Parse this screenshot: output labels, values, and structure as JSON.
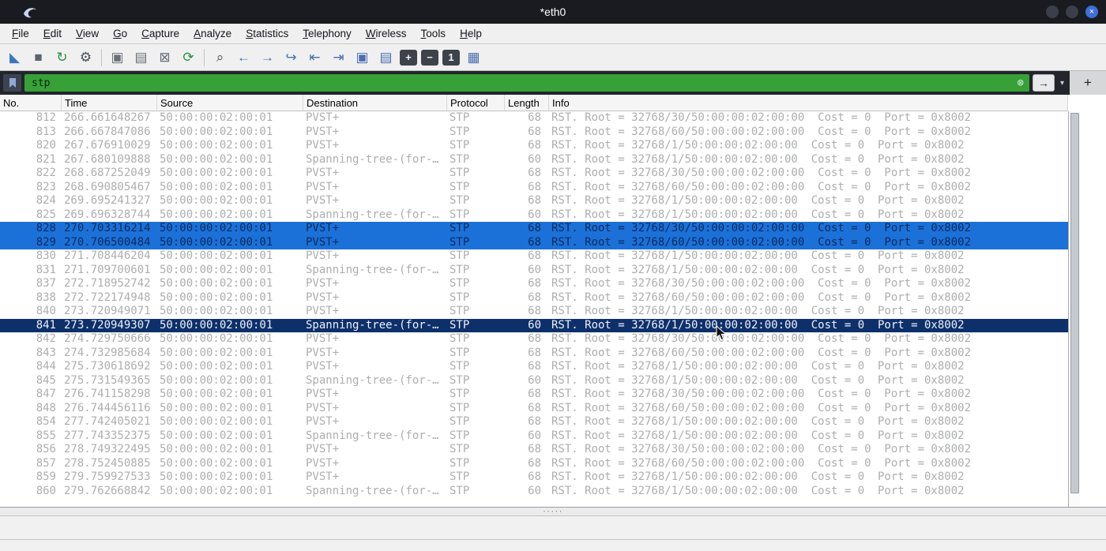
{
  "window": {
    "title": "*eth0",
    "controls": {
      "close_glyph": "×"
    }
  },
  "menu": {
    "items": [
      "File",
      "Edit",
      "View",
      "Go",
      "Capture",
      "Analyze",
      "Statistics",
      "Telephony",
      "Wireless",
      "Tools",
      "Help"
    ]
  },
  "toolbar": {
    "items": [
      {
        "type": "icon",
        "name": "start-capture-icon",
        "glyph": "◣",
        "color": "#3a76c4"
      },
      {
        "type": "icon",
        "name": "stop-capture-icon",
        "glyph": "■",
        "color": "#5c636e"
      },
      {
        "type": "icon",
        "name": "restart-capture-icon",
        "glyph": "↻",
        "color": "#2f8f3c"
      },
      {
        "type": "icon",
        "name": "capture-options-icon",
        "glyph": "⚙",
        "color": "#4a4f57"
      },
      {
        "type": "sep"
      },
      {
        "type": "icon",
        "name": "open-file-icon",
        "glyph": "▣",
        "color": "#6b7078"
      },
      {
        "type": "icon",
        "name": "save-file-icon",
        "glyph": "▤",
        "color": "#6b7078"
      },
      {
        "type": "icon",
        "name": "close-file-icon",
        "glyph": "⊠",
        "color": "#6b7078"
      },
      {
        "type": "icon",
        "name": "reload-file-icon",
        "glyph": "⟳",
        "color": "#2f8f3c"
      },
      {
        "type": "sep"
      },
      {
        "type": "icon",
        "name": "find-packet-icon",
        "glyph": "⌕",
        "color": "#4a4f57"
      },
      {
        "type": "icon",
        "name": "previous-packet-icon",
        "glyph": "←",
        "color": "#4a6fae"
      },
      {
        "type": "icon",
        "name": "next-packet-icon",
        "glyph": "→",
        "color": "#4a6fae"
      },
      {
        "type": "icon",
        "name": "goto-packet-icon",
        "glyph": "↪",
        "color": "#4a6fae"
      },
      {
        "type": "icon",
        "name": "first-packet-icon",
        "glyph": "⇤",
        "color": "#4a6fae"
      },
      {
        "type": "icon",
        "name": "last-packet-icon",
        "glyph": "⇥",
        "color": "#4a6fae"
      },
      {
        "type": "icon",
        "name": "auto-scroll-icon",
        "glyph": "▣",
        "color": "#4a6fae"
      },
      {
        "type": "icon",
        "name": "colorize-packets-icon",
        "glyph": "▤",
        "color": "#4a6fae"
      },
      {
        "type": "chip",
        "name": "zoom-in-button",
        "glyph": "+"
      },
      {
        "type": "chip",
        "name": "zoom-out-button",
        "glyph": "−"
      },
      {
        "type": "chip",
        "name": "normal-size-button",
        "glyph": "1"
      },
      {
        "type": "icon",
        "name": "resize-columns-icon",
        "glyph": "▦",
        "color": "#4a6fae"
      }
    ]
  },
  "filter": {
    "value": "stp",
    "clear_glyph": "⊗",
    "apply_glyph": "→",
    "dropdown_glyph": "▾",
    "add_label": "+"
  },
  "colors": {
    "filter_valid_bg": "#37a137",
    "row_selected_bg": "#1b71d8",
    "row_focused_bg": "#0d306b"
  },
  "splitter": {
    "grip": "·····"
  },
  "packet_table": {
    "columns": [
      "No.",
      "Time",
      "Source",
      "Destination",
      "Protocol",
      "Length",
      "Info"
    ],
    "rows": [
      {
        "no": "812",
        "time": "266.661648267",
        "source": "50:00:00:02:00:01",
        "destination": "PVST+",
        "protocol": "STP",
        "length": "68",
        "info": "RST. Root = 32768/30/50:00:00:02:00:00  Cost = 0  Port = 0x8002",
        "state": "normal"
      },
      {
        "no": "813",
        "time": "266.667847086",
        "source": "50:00:00:02:00:01",
        "destination": "PVST+",
        "protocol": "STP",
        "length": "68",
        "info": "RST. Root = 32768/60/50:00:00:02:00:00  Cost = 0  Port = 0x8002",
        "state": "normal"
      },
      {
        "no": "820",
        "time": "267.676910029",
        "source": "50:00:00:02:00:01",
        "destination": "PVST+",
        "protocol": "STP",
        "length": "68",
        "info": "RST. Root = 32768/1/50:00:00:02:00:00  Cost = 0  Port = 0x8002",
        "state": "normal"
      },
      {
        "no": "821",
        "time": "267.680109888",
        "source": "50:00:00:02:00:01",
        "destination": "Spanning-tree-(for-…",
        "protocol": "STP",
        "length": "60",
        "info": "RST. Root = 32768/1/50:00:00:02:00:00  Cost = 0  Port = 0x8002",
        "state": "normal"
      },
      {
        "no": "822",
        "time": "268.687252049",
        "source": "50:00:00:02:00:01",
        "destination": "PVST+",
        "protocol": "STP",
        "length": "68",
        "info": "RST. Root = 32768/30/50:00:00:02:00:00  Cost = 0  Port = 0x8002",
        "state": "normal"
      },
      {
        "no": "823",
        "time": "268.690805467",
        "source": "50:00:00:02:00:01",
        "destination": "PVST+",
        "protocol": "STP",
        "length": "68",
        "info": "RST. Root = 32768/60/50:00:00:02:00:00  Cost = 0  Port = 0x8002",
        "state": "normal"
      },
      {
        "no": "824",
        "time": "269.695241327",
        "source": "50:00:00:02:00:01",
        "destination": "PVST+",
        "protocol": "STP",
        "length": "68",
        "info": "RST. Root = 32768/1/50:00:00:02:00:00  Cost = 0  Port = 0x8002",
        "state": "normal"
      },
      {
        "no": "825",
        "time": "269.696328744",
        "source": "50:00:00:02:00:01",
        "destination": "Spanning-tree-(for-…",
        "protocol": "STP",
        "length": "60",
        "info": "RST. Root = 32768/1/50:00:00:02:00:00  Cost = 0  Port = 0x8002",
        "state": "normal"
      },
      {
        "no": "828",
        "time": "270.703316214",
        "source": "50:00:00:02:00:01",
        "destination": "PVST+",
        "protocol": "STP",
        "length": "68",
        "info": "RST. Root = 32768/30/50:00:00:02:00:00  Cost = 0  Port = 0x8002",
        "state": "selected"
      },
      {
        "no": "829",
        "time": "270.706500484",
        "source": "50:00:00:02:00:01",
        "destination": "PVST+",
        "protocol": "STP",
        "length": "68",
        "info": "RST. Root = 32768/60/50:00:00:02:00:00  Cost = 0  Port = 0x8002",
        "state": "selected"
      },
      {
        "no": "830",
        "time": "271.708446204",
        "source": "50:00:00:02:00:01",
        "destination": "PVST+",
        "protocol": "STP",
        "length": "68",
        "info": "RST. Root = 32768/1/50:00:00:02:00:00  Cost = 0  Port = 0x8002",
        "state": "normal"
      },
      {
        "no": "831",
        "time": "271.709700601",
        "source": "50:00:00:02:00:01",
        "destination": "Spanning-tree-(for-…",
        "protocol": "STP",
        "length": "60",
        "info": "RST. Root = 32768/1/50:00:00:02:00:00  Cost = 0  Port = 0x8002",
        "state": "normal"
      },
      {
        "no": "837",
        "time": "272.718952742",
        "source": "50:00:00:02:00:01",
        "destination": "PVST+",
        "protocol": "STP",
        "length": "68",
        "info": "RST. Root = 32768/30/50:00:00:02:00:00  Cost = 0  Port = 0x8002",
        "state": "normal"
      },
      {
        "no": "838",
        "time": "272.722174948",
        "source": "50:00:00:02:00:01",
        "destination": "PVST+",
        "protocol": "STP",
        "length": "68",
        "info": "RST. Root = 32768/60/50:00:00:02:00:00  Cost = 0  Port = 0x8002",
        "state": "normal"
      },
      {
        "no": "840",
        "time": "273.720949071",
        "source": "50:00:00:02:00:01",
        "destination": "PVST+",
        "protocol": "STP",
        "length": "68",
        "info": "RST. Root = 32768/1/50:00:00:02:00:00  Cost = 0  Port = 0x8002",
        "state": "normal"
      },
      {
        "no": "841",
        "time": "273.720949307",
        "source": "50:00:00:02:00:01",
        "destination": "Spanning-tree-(for-…",
        "protocol": "STP",
        "length": "60",
        "info": "RST. Root = 32768/1/50:00:00:02:00:00  Cost = 0  Port = 0x8002",
        "state": "focused"
      },
      {
        "no": "842",
        "time": "274.729750666",
        "source": "50:00:00:02:00:01",
        "destination": "PVST+",
        "protocol": "STP",
        "length": "68",
        "info": "RST. Root = 32768/30/50:00:00:02:00:00  Cost = 0  Port = 0x8002",
        "state": "normal"
      },
      {
        "no": "843",
        "time": "274.732985684",
        "source": "50:00:00:02:00:01",
        "destination": "PVST+",
        "protocol": "STP",
        "length": "68",
        "info": "RST. Root = 32768/60/50:00:00:02:00:00  Cost = 0  Port = 0x8002",
        "state": "normal"
      },
      {
        "no": "844",
        "time": "275.730618692",
        "source": "50:00:00:02:00:01",
        "destination": "PVST+",
        "protocol": "STP",
        "length": "68",
        "info": "RST. Root = 32768/1/50:00:00:02:00:00  Cost = 0  Port = 0x8002",
        "state": "normal"
      },
      {
        "no": "845",
        "time": "275.731549365",
        "source": "50:00:00:02:00:01",
        "destination": "Spanning-tree-(for-…",
        "protocol": "STP",
        "length": "60",
        "info": "RST. Root = 32768/1/50:00:00:02:00:00  Cost = 0  Port = 0x8002",
        "state": "normal"
      },
      {
        "no": "847",
        "time": "276.741158298",
        "source": "50:00:00:02:00:01",
        "destination": "PVST+",
        "protocol": "STP",
        "length": "68",
        "info": "RST. Root = 32768/30/50:00:00:02:00:00  Cost = 0  Port = 0x8002",
        "state": "normal"
      },
      {
        "no": "848",
        "time": "276.744456116",
        "source": "50:00:00:02:00:01",
        "destination": "PVST+",
        "protocol": "STP",
        "length": "68",
        "info": "RST. Root = 32768/60/50:00:00:02:00:00  Cost = 0  Port = 0x8002",
        "state": "normal"
      },
      {
        "no": "854",
        "time": "277.742405021",
        "source": "50:00:00:02:00:01",
        "destination": "PVST+",
        "protocol": "STP",
        "length": "68",
        "info": "RST. Root = 32768/1/50:00:00:02:00:00  Cost = 0  Port = 0x8002",
        "state": "normal"
      },
      {
        "no": "855",
        "time": "277.743352375",
        "source": "50:00:00:02:00:01",
        "destination": "Spanning-tree-(for-…",
        "protocol": "STP",
        "length": "60",
        "info": "RST. Root = 32768/1/50:00:00:02:00:00  Cost = 0  Port = 0x8002",
        "state": "normal"
      },
      {
        "no": "856",
        "time": "278.749322495",
        "source": "50:00:00:02:00:01",
        "destination": "PVST+",
        "protocol": "STP",
        "length": "68",
        "info": "RST. Root = 32768/30/50:00:00:02:00:00  Cost = 0  Port = 0x8002",
        "state": "normal"
      },
      {
        "no": "857",
        "time": "278.752450885",
        "source": "50:00:00:02:00:01",
        "destination": "PVST+",
        "protocol": "STP",
        "length": "68",
        "info": "RST. Root = 32768/60/50:00:00:02:00:00  Cost = 0  Port = 0x8002",
        "state": "normal"
      },
      {
        "no": "859",
        "time": "279.759927533",
        "source": "50:00:00:02:00:01",
        "destination": "PVST+",
        "protocol": "STP",
        "length": "68",
        "info": "RST. Root = 32768/1/50:00:00:02:00:00  Cost = 0  Port = 0x8002",
        "state": "normal"
      },
      {
        "no": "860",
        "time": "279.762668842",
        "source": "50:00:00:02:00:01",
        "destination": "Spanning-tree-(for-…",
        "protocol": "STP",
        "length": "60",
        "info": "RST. Root = 32768/1/50:00:00:02:00:00  Cost = 0  Port = 0x8002",
        "state": "normal"
      }
    ]
  }
}
